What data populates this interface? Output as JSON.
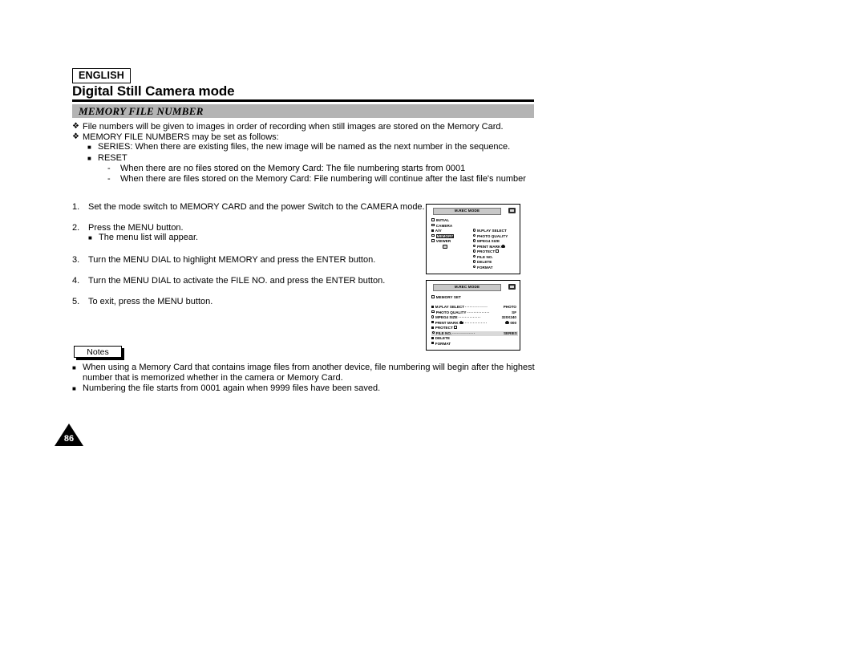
{
  "header": {
    "language": "ENGLISH",
    "title": "Digital Still Camera mode"
  },
  "section": {
    "heading": "MEMORY FILE NUMBER"
  },
  "intro": {
    "bullets": [
      {
        "marker": "❖",
        "level": 1,
        "text": "File numbers will be given to images in order of recording when still images are stored on the Memory Card."
      },
      {
        "marker": "❖",
        "level": 1,
        "text": "MEMORY FILE NUMBERS may be set as follows:"
      },
      {
        "marker": "■",
        "level": 2,
        "text": "SERIES: When there are existing files, the new image will be named as the next number in the sequence."
      },
      {
        "marker": "■",
        "level": 2,
        "text": "RESET"
      },
      {
        "marker": "-",
        "level": 3,
        "text": "When there are no files stored on the Memory Card: The file numbering starts from 0001"
      },
      {
        "marker": "-",
        "level": 3,
        "text": "When there are files stored on the Memory Card: File numbering will continue after the last file's number"
      }
    ]
  },
  "steps": [
    {
      "number": "1.",
      "text": "Set the mode switch to MEMORY CARD and the power Switch to the CAMERA mode.",
      "sub": []
    },
    {
      "number": "2.",
      "text": "Press the MENU button.",
      "sub": [
        {
          "marker": "■",
          "text": "The menu list will appear."
        }
      ]
    },
    {
      "number": "3.",
      "text": "Turn the MENU DIAL to highlight MEMORY and press the ENTER button.",
      "sub": []
    },
    {
      "number": "4.",
      "text": "Turn the MENU DIAL to activate the FILE NO. and press the ENTER button.",
      "sub": []
    },
    {
      "number": "5.",
      "text": "To exit, press the MENU button.",
      "sub": []
    }
  ],
  "lcd_screen_1": {
    "title": "M.REC MODE",
    "card_icon": "memory-card-icon",
    "left_menu": [
      {
        "label": "INITIAL",
        "selected": false
      },
      {
        "label": "CAMERA",
        "selected": false
      },
      {
        "label": "A/V",
        "selected": false
      },
      {
        "label": "MEMORY",
        "selected": true
      },
      {
        "label": "VIEWER",
        "selected": false
      }
    ],
    "right_menu": [
      {
        "label": "M.PLAY SELECT"
      },
      {
        "label": "PHOTO QUALITY"
      },
      {
        "label": "MPEG4 SIZE"
      },
      {
        "label": "PRINT MARK"
      },
      {
        "label": "PROTECT"
      },
      {
        "label": "FILE NO."
      },
      {
        "label": "DELETE"
      },
      {
        "label": "FORMAT"
      }
    ]
  },
  "lcd_screen_2": {
    "title": "M.REC MODE",
    "card_icon": "memory-card-icon",
    "submenu_title": "MEMORY SET",
    "rows": [
      {
        "label": "M.PLAY SELECT",
        "value": "PHOTO",
        "highlighted": false
      },
      {
        "label": "PHOTO QUALITY",
        "value": "SF",
        "highlighted": false
      },
      {
        "label": "MPEG4 SIZE",
        "value": "320X240",
        "highlighted": false
      },
      {
        "label": "PRINT MARK",
        "value": "000",
        "highlighted": false
      },
      {
        "label": "PROTECT",
        "value": "",
        "highlighted": false
      },
      {
        "label": "FILE NO.",
        "value": "SERIES",
        "highlighted": true
      },
      {
        "label": "DELETE",
        "value": "",
        "highlighted": false
      },
      {
        "label": "FORMAT",
        "value": "",
        "highlighted": false
      }
    ]
  },
  "notes": {
    "tab_label": "Notes",
    "items": [
      {
        "marker": "■",
        "text": "When using a Memory Card that contains image files from another device, file numbering will begin after the highest number that is memorized whether in the camera or Memory Card."
      },
      {
        "marker": "■",
        "text": "Numbering the file starts from 0001 again when 9999 files have been saved."
      }
    ]
  },
  "footer": {
    "page_number": "86"
  }
}
